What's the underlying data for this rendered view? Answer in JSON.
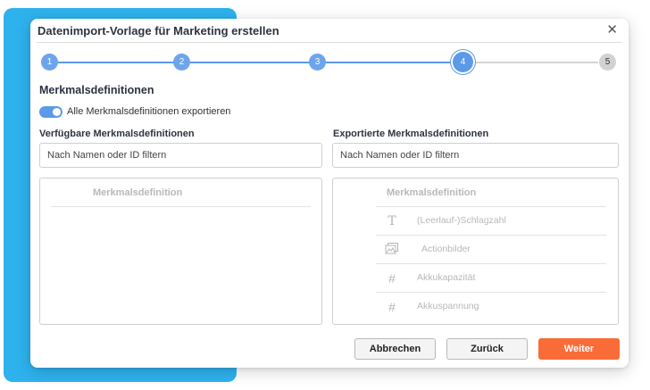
{
  "dialog": {
    "title": "Datenimport-Vorlage für Marketing erstellen",
    "close_icon": "close-icon"
  },
  "stepper": {
    "steps": [
      "1",
      "2",
      "3",
      "4",
      "5"
    ],
    "active_step": 4,
    "accent_color": "#5b9ae8"
  },
  "section": {
    "title": "Merkmalsdefinitionen",
    "toggle_label": "Alle Merkmalsdefinitionen exportieren",
    "toggle_on": true
  },
  "available": {
    "heading": "Verfügbare Merkmalsdefinitionen",
    "filter_placeholder": "Nach Namen oder ID filtern",
    "column_header": "Merkmalsdefinition"
  },
  "exported": {
    "heading": "Exportierte Merkmalsdefinitionen",
    "filter_placeholder": "Nach Namen oder ID filtern",
    "column_header": "Merkmalsdefinition",
    "items": [
      {
        "icon": "text-type-icon",
        "label": "(Leerlauf-)Schlagzahl"
      },
      {
        "icon": "image-gallery-icon",
        "label": "Actionbilder"
      },
      {
        "icon": "number-hash-icon",
        "label": "Akkukapazität"
      },
      {
        "icon": "number-hash-icon",
        "label": "Akkuspannung"
      }
    ]
  },
  "footer": {
    "cancel_label": "Abbrechen",
    "back_label": "Zurück",
    "next_label": "Weiter",
    "primary_color": "#f96b37"
  }
}
